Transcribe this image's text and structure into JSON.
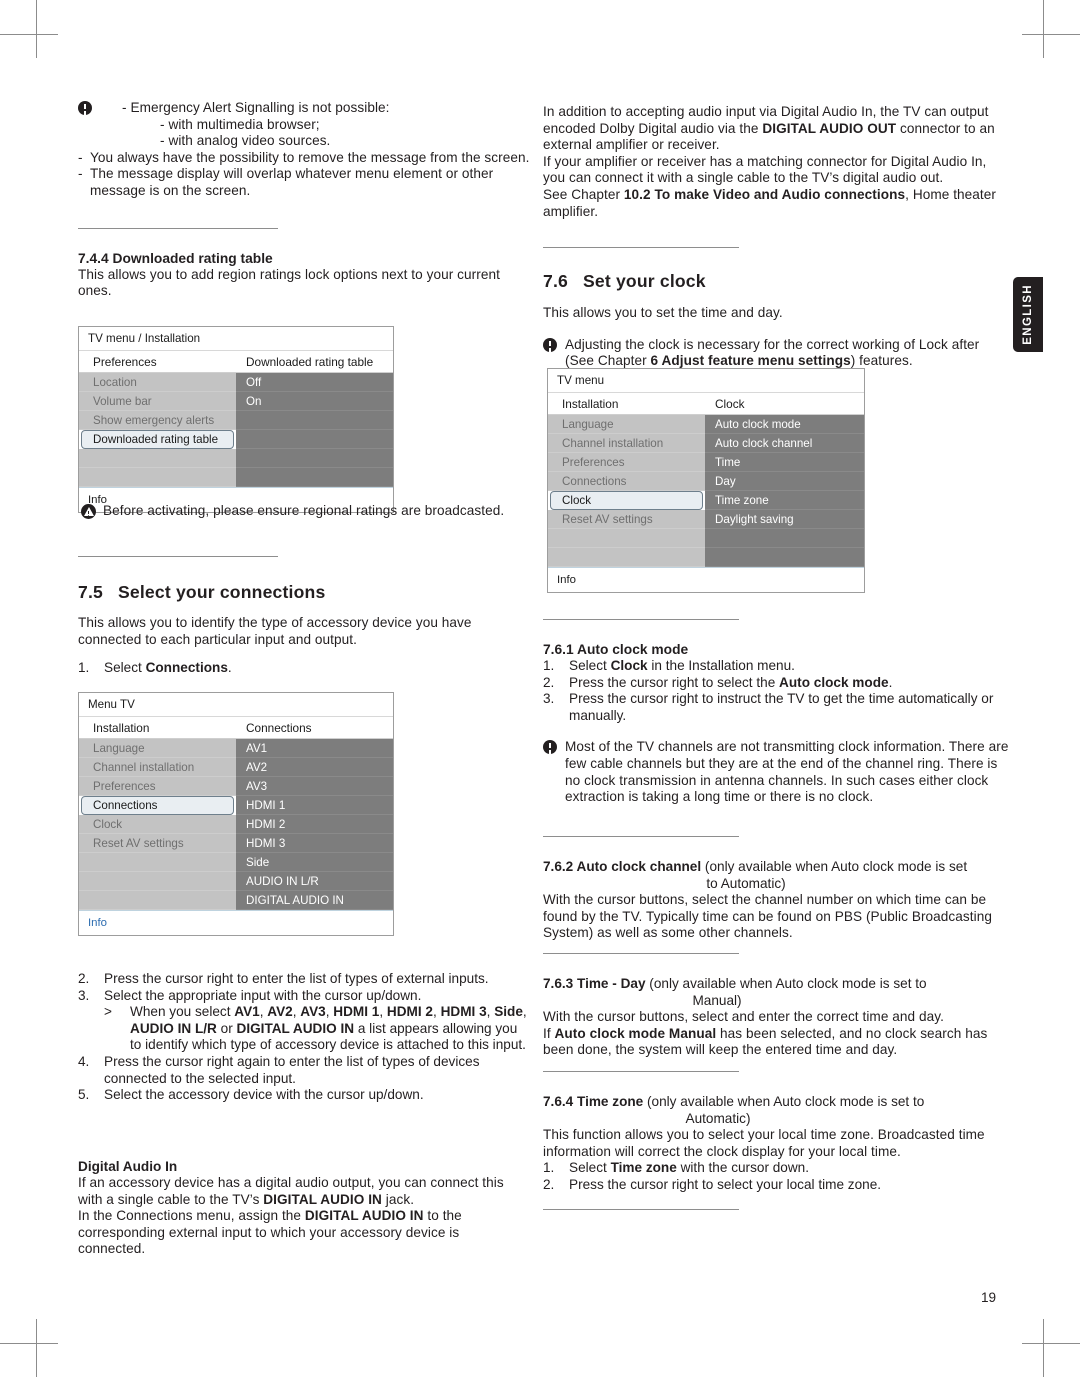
{
  "page": {
    "number": "19",
    "side_tab": "ENGLISH"
  },
  "left_column": {
    "note_emergency": {
      "icon": "warning-exclamation-icon",
      "line1": "- Emergency Alert Signalling is not possible:",
      "line2": "- with multimedia browser;",
      "line3": "- with analog video sources."
    },
    "bullets": [
      {
        "dash": "-",
        "text": "You always have the possibility to remove the message from the screen."
      },
      {
        "dash": "-",
        "text": "The message display will overlap whatever menu element or other message is on the screen."
      }
    ],
    "section_744": {
      "heading": "7.4.4 Downloaded rating table",
      "body": "This allows you to add region ratings lock options next to your current ones."
    },
    "menu_rating": {
      "title": "TV menu / Installation",
      "left_header": "Preferences",
      "right_header": "Downloaded rating table",
      "left_items": [
        "Location",
        "Volume bar",
        "Show emergency alerts",
        "Downloaded rating table",
        ""
      ],
      "selected_left": "Downloaded rating table",
      "right_items": [
        "Off",
        "On",
        "",
        "",
        ""
      ],
      "footer": "Info"
    },
    "note_ratings": {
      "icon": "warning-triangle-icon",
      "text": "Before activating, please ensure regional ratings are broadcasted."
    },
    "section_75": {
      "number": "7.5",
      "title": "Select your connections",
      "body": "This allows you to identify the type of accessory device you have connected to each particular input and output.",
      "step1_num": "1.",
      "step1_a": "Select ",
      "step1_b": "Connections",
      "step1_c": "."
    },
    "menu_connections": {
      "title": "Menu TV",
      "left_header": "Installation",
      "right_header": "Connections",
      "left_items": [
        "Language",
        "Channel installation",
        "Preferences",
        "Connections",
        "Clock",
        "Reset AV settings",
        "",
        "",
        ""
      ],
      "selected_left": "Connections",
      "right_items": [
        "AV1",
        "AV2",
        "AV3",
        "HDMI 1",
        "HDMI 2",
        "HDMI 3",
        "Side",
        "AUDIO IN L/R",
        "DIGITAL AUDIO IN"
      ],
      "footer": "Info"
    },
    "steps": [
      {
        "num": "2.",
        "text": "Press the cursor right to enter the list of types of external inputs."
      },
      {
        "num": "3.",
        "text": "Select the appropriate input with the cursor up/down."
      }
    ],
    "substep": {
      "marker": ">",
      "prefix": "When you select ",
      "bold_items": [
        "AV1",
        "AV2",
        "AV3",
        "HDMI 1",
        "HDMI 2",
        "HDMI 3",
        "Side",
        "AUDIO IN L/R"
      ],
      "mid": " or ",
      "bold_last": "DIGITAL AUDIO IN",
      "suffix": " a list appears allowing you to identify which type of accessory device is attached to this input."
    },
    "steps2": [
      {
        "num": "4.",
        "text": "Press the cursor right again to enter the list of types of devices connected to the selected input."
      },
      {
        "num": "5.",
        "text": "Select the accessory device with the cursor up/down."
      }
    ],
    "digital_audio_in": {
      "heading": "Digital Audio In",
      "p1_a": "If an accessory device has a digital audio output, you can connect this with a single cable to the TV’s ",
      "p1_b": "DIGITAL AUDIO IN",
      "p1_c": " jack.",
      "p2_a": "In the Connections menu, assign the ",
      "p2_b": "DIGITAL AUDIO IN",
      "p2_c": " to the corresponding external input to which your accessory device is connected."
    }
  },
  "right_column": {
    "intro": {
      "p1_a": "In addition to accepting audio input via Digital Audio In, the TV can output encoded Dolby Digital audio via the ",
      "p1_b": "DIGITAL AUDIO OUT",
      "p1_c": " connector to an external amplifier or receiver.",
      "p2": "If your amplifier or receiver has a matching connector for Digital Audio In, you can connect it with a single cable to the TV’s digital audio out.",
      "p3_a": "See Chapter ",
      "p3_b": "10.2 To make Video and Audio connections",
      "p3_c": ", Home theater amplifier."
    },
    "section_76": {
      "number": "7.6",
      "title": "Set your clock",
      "body": "This allows you to set the time and day.",
      "note_icon": "warning-exclamation-icon",
      "note_a": "Adjusting the clock is necessary for the correct working of Lock after (See Chapter ",
      "note_b": "6 Adjust feature menu settings",
      "note_c": ") features."
    },
    "menu_clock": {
      "title": "TV menu",
      "left_header": "Installation",
      "right_header": "Clock",
      "left_items": [
        "Language",
        "Channel installation",
        "Preferences",
        "Connections",
        "Clock",
        "Reset AV settings",
        "",
        ""
      ],
      "selected_left": "Clock",
      "right_items": [
        "Auto clock mode",
        "Auto clock channel",
        "Time",
        "Day",
        "Time zone",
        "Daylight saving",
        "",
        ""
      ],
      "footer": "Info"
    },
    "section_761": {
      "heading": "7.6.1 Auto clock mode",
      "steps": [
        {
          "num": "1.",
          "a": "Select ",
          "b": "Clock",
          "c": " in the Installation menu."
        },
        {
          "num": "2.",
          "a": "Press the cursor right to select the ",
          "b": "Auto clock mode",
          "c": "."
        },
        {
          "num": "3.",
          "a": "Press the cursor right to instruct the TV to get the time automatically or manually.",
          "b": "",
          "c": ""
        }
      ],
      "note_icon": "warning-exclamation-icon",
      "note": "Most of the TV channels are not transmitting clock information. There are few cable channels but they are at the end of the channel ring. There is no clock transmission in antenna channels. In such cases either clock extraction is taking a long time or there is no clock."
    },
    "section_762": {
      "heading_a": "7.6.2  Auto clock channel",
      "heading_b": " (only available when Auto clock mode is set",
      "heading_c": "to Automatic)",
      "body": "With the cursor buttons, select the channel number on which time can be found by the TV. Typically time can be found on PBS (Public Broadcasting System) as well as some other channels."
    },
    "section_763": {
      "heading_a": "7.6.3 Time - Day",
      "heading_b": " (only available when Auto clock mode is set to",
      "heading_c": "Manual)",
      "body1": "With the cursor buttons, select and enter the correct time and day.",
      "body2_a": "If ",
      "body2_b": "Auto clock mode Manual",
      "body2_c": " has been selected, and no clock search has been done, the system will keep the entered time and day."
    },
    "section_764": {
      "heading_a": "7.6.4 Time zone",
      "heading_b": " (only available when Auto clock mode is set to",
      "heading_c": "Automatic)",
      "body": "This function allows you to select your local time zone. Broadcasted time information will correct the clock display for your local time.",
      "steps": [
        {
          "num": "1.",
          "a": "Select ",
          "b": "Time zone",
          "c": " with the cursor down."
        },
        {
          "num": "2.",
          "a": "Press the cursor right to select your local time zone.",
          "b": "",
          "c": ""
        }
      ]
    }
  }
}
